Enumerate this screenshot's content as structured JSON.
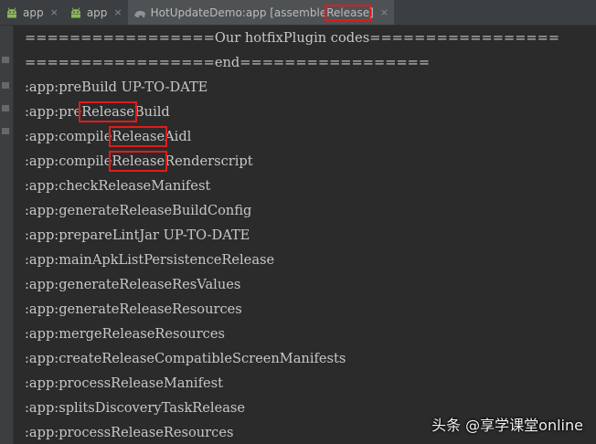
{
  "tabs": [
    {
      "label": "app",
      "icon": "android-icon",
      "close": "×"
    },
    {
      "label": "app",
      "icon": "android-icon",
      "close": "×"
    },
    {
      "label_prefix": "HotUpdateDemo:app [assemble",
      "label_highlight": "Release",
      "label_suffix": "]",
      "icon": "gradle-icon",
      "close": "×"
    }
  ],
  "console": {
    "lines": [
      "=================Our hotfixPlugin codes=================",
      "=================end=================",
      ":app:preBuild UP-TO-DATE",
      {
        "prefix": ":app:pre",
        "highlight": "Release",
        "suffix": "Build"
      },
      {
        "prefix": ":app:compile",
        "highlight": "Release",
        "suffix": "Aidl"
      },
      {
        "prefix": ":app:compile",
        "highlight": "Release",
        "suffix": "Renderscript"
      },
      ":app:checkReleaseManifest",
      ":app:generateReleaseBuildConfig",
      ":app:prepareLintJar UP-TO-DATE",
      ":app:mainApkListPersistenceRelease",
      ":app:generateReleaseResValues",
      ":app:generateReleaseResources",
      ":app:mergeReleaseResources",
      ":app:createReleaseCompatibleScreenManifests",
      ":app:processReleaseManifest",
      ":app:splitsDiscoveryTaskRelease",
      ":app:processReleaseResources"
    ]
  },
  "watermark": "头条 @享学课堂online",
  "colors": {
    "background": "#2b2b2b",
    "text": "#c8c8c8",
    "highlight_box": "#e01b1b",
    "tabbar": "#3c3f41"
  }
}
